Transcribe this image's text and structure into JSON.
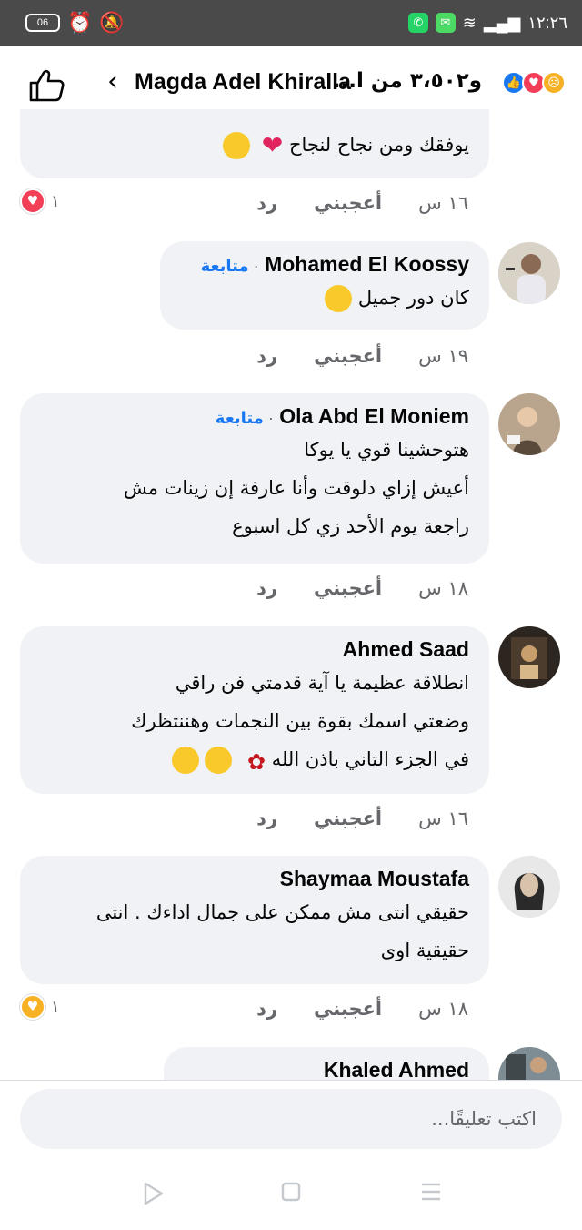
{
  "status_bar": {
    "battery": "06",
    "time": "١٢:٢٦"
  },
  "header": {
    "title": "Magda Adel Khiralla",
    "count_text": "و٣،٥٠٢ من ا...",
    "reactions": [
      "sad",
      "love",
      "like"
    ]
  },
  "comments": [
    {
      "text": "يوفقك ومن نجاح لنجاح",
      "time": "١٦ س",
      "like_label": "أعجبني",
      "reply_label": "رد",
      "reaction_count": "١"
    },
    {
      "name": "Mohamed El Koossy",
      "follow_label": "متابعة",
      "text": "كان دور جميل",
      "time": "١٩ س",
      "like_label": "أعجبني",
      "reply_label": "رد"
    },
    {
      "name": "Ola Abd El Moniem",
      "follow_label": "متابعة",
      "lines": [
        "هتوحشينا قوي يا يوكا",
        "أعيش إزاي دلوقت وأنا عارفة إن زينات مش",
        "راجعة يوم الأحد زي كل اسبوع"
      ],
      "time": "١٨ س",
      "like_label": "أعجبني",
      "reply_label": "رد"
    },
    {
      "name": "Ahmed Saad",
      "lines": [
        "انطلاقة عظيمة يا آية  قدمتي فن راقي",
        "وضعتي اسمك بقوة بين  النجمات وهننتظرك",
        "في الجزء التاني باذن الله"
      ],
      "time": "١٦ س",
      "like_label": "أعجبني",
      "reply_label": "رد"
    },
    {
      "name": "Shaymaa Moustafa",
      "lines": [
        "حقيقي انتى مش ممكن على جمال اداءك . انتى",
        "حقيقية اوى"
      ],
      "time": "١٨ س",
      "like_label": "أعجبني",
      "reply_label": "رد",
      "reaction_count": "١"
    },
    {
      "name": "Khaled Ahmed"
    }
  ],
  "composer": {
    "placeholder": "اكتب تعليقًا..."
  },
  "nav": [
    "back-icon",
    "home-icon",
    "recents-icon"
  ]
}
